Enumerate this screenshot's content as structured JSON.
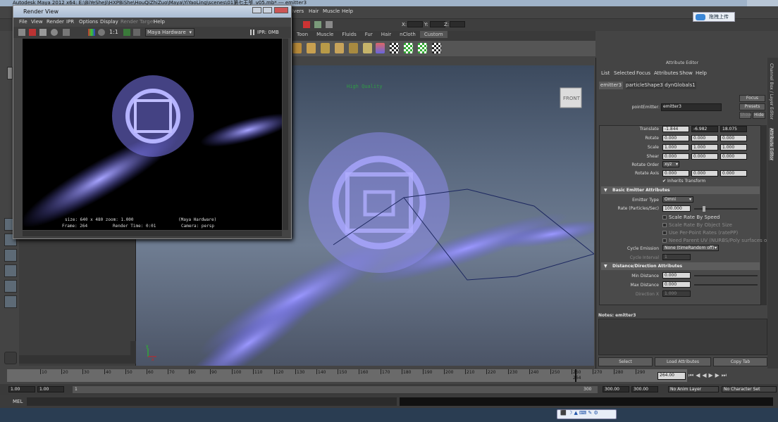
{
  "window": {
    "title": "Autodesk Maya 2012 x64: E:\\BiYeSheJi\\HXPBiShe\\HouQiZhiZuo\\Maya\\YiYaoLing\\scenes\\01第七王爷_v05.mb*  ---  emitter3"
  },
  "main_menu": {
    "items": [
      "olvers",
      "Hair",
      "Muscle",
      "Help"
    ]
  },
  "status": {
    "x_label": "X:",
    "y_label": "Y:",
    "z_label": "Z:",
    "upload_label": "拖拽上传"
  },
  "shelf": {
    "tabs": [
      "Toon",
      "Muscle",
      "Fluids",
      "Fur",
      "Hair",
      "nCloth",
      "Custom"
    ]
  },
  "viewport": {
    "quality_label": "High Quality",
    "viewcube_label": "FRONT",
    "axis_y": "y",
    "axis_x": "x"
  },
  "render_view": {
    "title": "Render View",
    "menu": [
      "File",
      "View",
      "Render",
      "IPR",
      "Options",
      "Display",
      "Render Target",
      "Help"
    ],
    "ratio_label": "1:1",
    "renderer_select": "Maya Hardware",
    "ipr_label": "IPR: 0MB",
    "info": {
      "size": "size: 640 x 480 zoom: 1.000",
      "renderer": "(Maya Hardware)",
      "frame": "Frame: 264",
      "render_time": "Render Time: 0:01",
      "camera": "Camera: persp"
    }
  },
  "attribute_editor": {
    "header": "Attribute Editor",
    "menu": [
      "List",
      "Selected",
      "Focus",
      "Attributes",
      "Show",
      "Help"
    ],
    "tabs": [
      "emitter3",
      "particleShape3",
      "dynGlobals1"
    ],
    "node_label": "pointEmitter:",
    "node_value": "emitter3",
    "focus_button": "Focus",
    "presets_button": "Presets",
    "show_button": "Show",
    "hide_button": "Hide",
    "translate": {
      "label": "Translate",
      "values": [
        "-1.844",
        "-6.982",
        "18.075"
      ]
    },
    "rotate": {
      "label": "Rotate",
      "values": [
        "0.000",
        "0.000",
        "0.000"
      ]
    },
    "scale": {
      "label": "Scale",
      "values": [
        "1.000",
        "1.000",
        "1.000"
      ]
    },
    "shear": {
      "label": "Shear",
      "values": [
        "0.000",
        "0.000",
        "0.000"
      ]
    },
    "rotate_order": {
      "label": "Rotate Order",
      "value": "xyz"
    },
    "rotate_axis": {
      "label": "Rotate Axis",
      "values": [
        "0.000",
        "0.000",
        "0.000"
      ]
    },
    "inherits_transform": "Inherits Transform",
    "basic_section": "Basic Emitter Attributes",
    "emitter_type": {
      "label": "Emitter Type",
      "value": "Omni"
    },
    "rate": {
      "label": "Rate (Particles/Sec)",
      "value": "100.000"
    },
    "scale_rate_speed": "Scale Rate By Speed",
    "scale_rate_object": "Scale Rate By Object Size",
    "per_point_rates": "Use Per-Point Rates (ratePP)",
    "need_parent_uv": "Need Parent UV (NURBS/Poly surfaces only)",
    "cycle_emission": {
      "label": "Cycle Emission",
      "value": "None (timeRandom off)"
    },
    "cycle_interval": {
      "label": "Cycle Interval",
      "value": "1"
    },
    "distance_section": "Distance/Direction Attributes",
    "min_distance": {
      "label": "Min Distance",
      "value": "0.000"
    },
    "max_distance": {
      "label": "Max Distance",
      "value": "0.000"
    },
    "direction_x": {
      "label": "Direction X",
      "value": "1.000"
    },
    "notes_label": "Notes:  emitter3",
    "buttons": [
      "Select",
      "Load Attributes",
      "Copy Tab"
    ]
  },
  "side_tabs": [
    "Channel Box / Layer Editor",
    "Attribute Editor"
  ],
  "timeline": {
    "ticks": [
      "10",
      "20",
      "30",
      "40",
      "50",
      "60",
      "70",
      "80",
      "90",
      "100",
      "110",
      "120",
      "130",
      "140",
      "150",
      "160",
      "170",
      "180",
      "190",
      "200",
      "210",
      "220",
      "230",
      "240",
      "250",
      "260",
      "270",
      "280",
      "290"
    ],
    "current_marker": "264",
    "current_frame": "264.00",
    "range_start_outer": "1.00",
    "range_start_inner": "1.00",
    "range_slider_start": "1",
    "range_slider_end": "300",
    "range_end_inner": "300.00",
    "range_end_outer": "300.00",
    "anim_layer": "No Anim Layer",
    "character_set": "No Character Set",
    "mel_label": "MEL"
  },
  "colors": {
    "accent": "#6e6cff",
    "panel": "#444444",
    "field_dark": "#2b2b2b"
  }
}
